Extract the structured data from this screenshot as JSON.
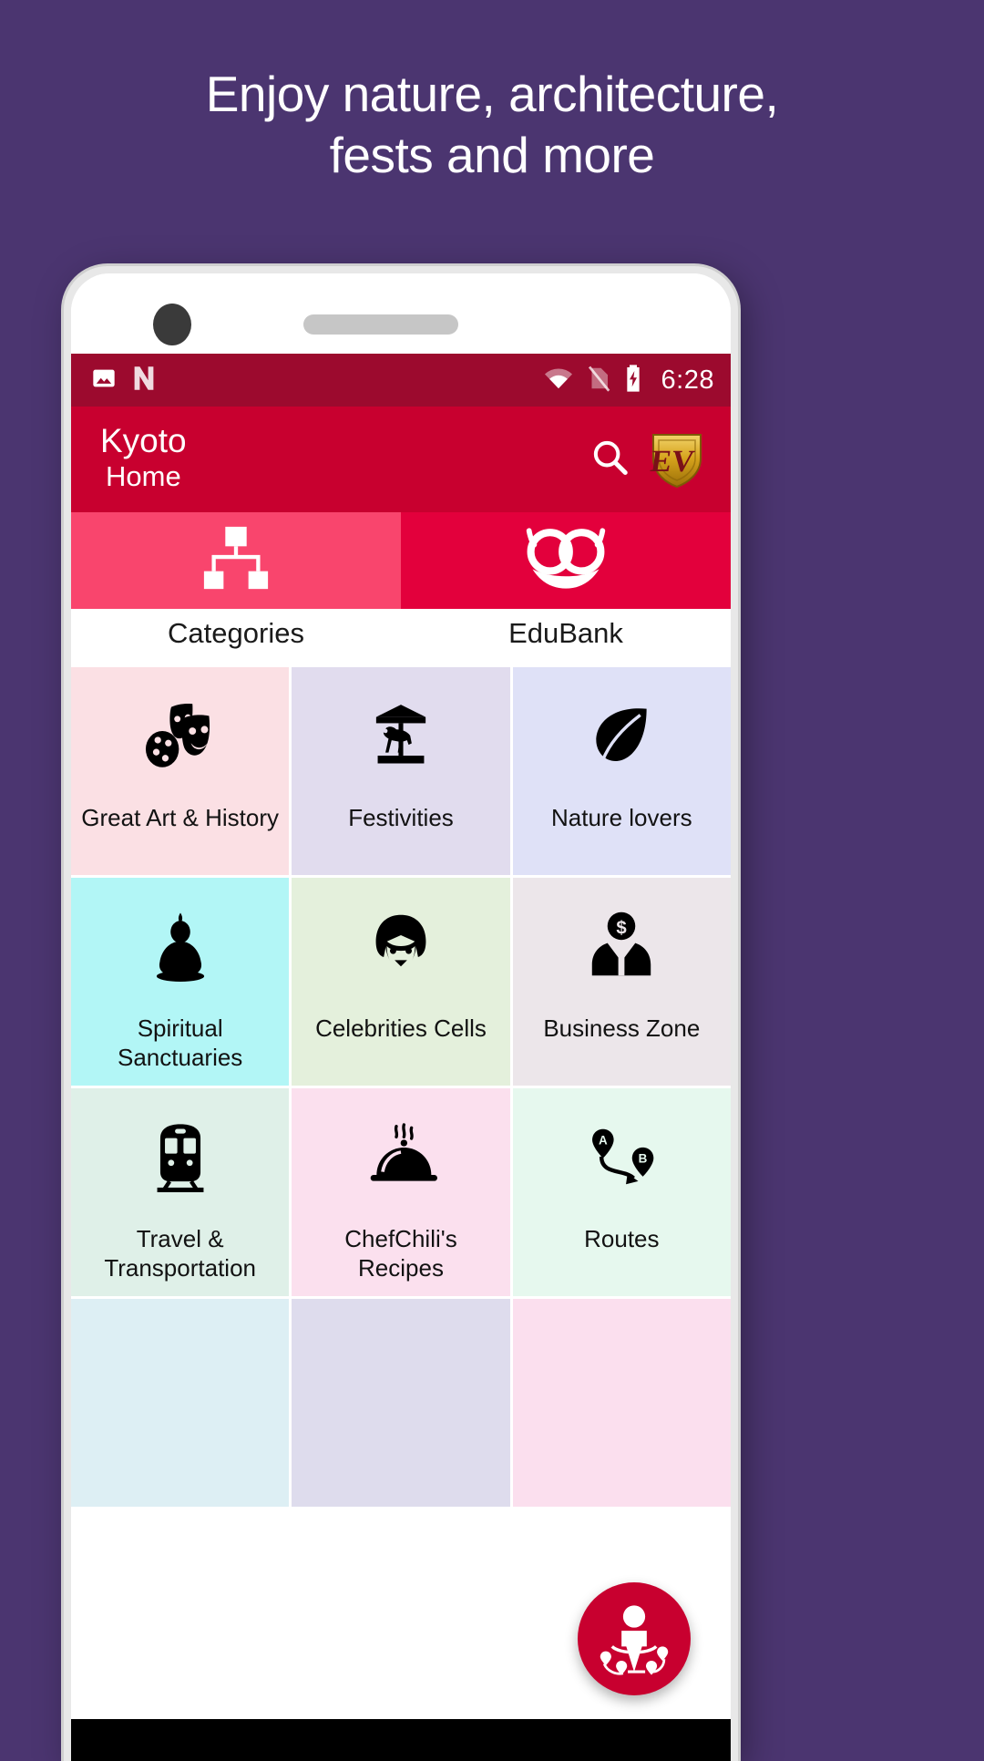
{
  "promo": {
    "headline_line1": "Enjoy nature, architecture,",
    "headline_line2": "fests and more"
  },
  "status_bar": {
    "time": "6:28",
    "icons": [
      "image-icon",
      "nova-launcher-icon",
      "wifi-icon",
      "sim-off-icon",
      "battery-charging-icon"
    ]
  },
  "app_bar": {
    "title": "Kyoto",
    "subtitle": "Home",
    "search_icon": "search-icon",
    "logo_text": "EV",
    "logo_name": "edu-visiting-logo"
  },
  "tabs": [
    {
      "label": "Categories",
      "icon": "hierarchy-icon",
      "active": true
    },
    {
      "label": "EduBank",
      "icon": "owl-icon",
      "active": false
    }
  ],
  "categories": [
    {
      "label": "Great Art & History",
      "icon": "theater-masks-palette-icon",
      "bg": "#fbe0e4"
    },
    {
      "label": "Festivities",
      "icon": "carousel-icon",
      "bg": "#e1dcee"
    },
    {
      "label": "Nature lovers",
      "icon": "leaf-icon",
      "bg": "#dfe1f7"
    },
    {
      "label": "Spiritual Sanctuaries",
      "icon": "buddha-icon",
      "bg": "#b2f6f6"
    },
    {
      "label": "Celebrities Cells",
      "icon": "celebrity-face-icon",
      "bg": "#e4f0dc"
    },
    {
      "label": "Business Zone",
      "icon": "businessman-dollar-icon",
      "bg": "#ece6ea"
    },
    {
      "label": "Travel & Transportation",
      "icon": "train-icon",
      "bg": "#dff0e8"
    },
    {
      "label": "ChefChili's Recipes",
      "icon": "food-dome-icon",
      "bg": "#fbe0ee"
    },
    {
      "label": "Routes",
      "icon": "route-a-b-icon",
      "bg": "#e6f8ee"
    },
    {
      "label": "",
      "icon": "",
      "bg": "#ddeff4"
    },
    {
      "label": "",
      "icon": "",
      "bg": "#dedced"
    },
    {
      "label": "",
      "icon": "",
      "bg": "#fbdfee"
    }
  ],
  "fab": {
    "name": "nearby-places-fab",
    "icon": "person-with-location-pins-icon"
  },
  "colors": {
    "promo_background": "#4b3570",
    "status_bar": "#9c0a2e",
    "app_bar": "#c8002f",
    "tab_active": "#f9456d",
    "tab_inactive": "#e3003c",
    "fab": "#c8002f",
    "logo_gold": "#d9a520"
  }
}
